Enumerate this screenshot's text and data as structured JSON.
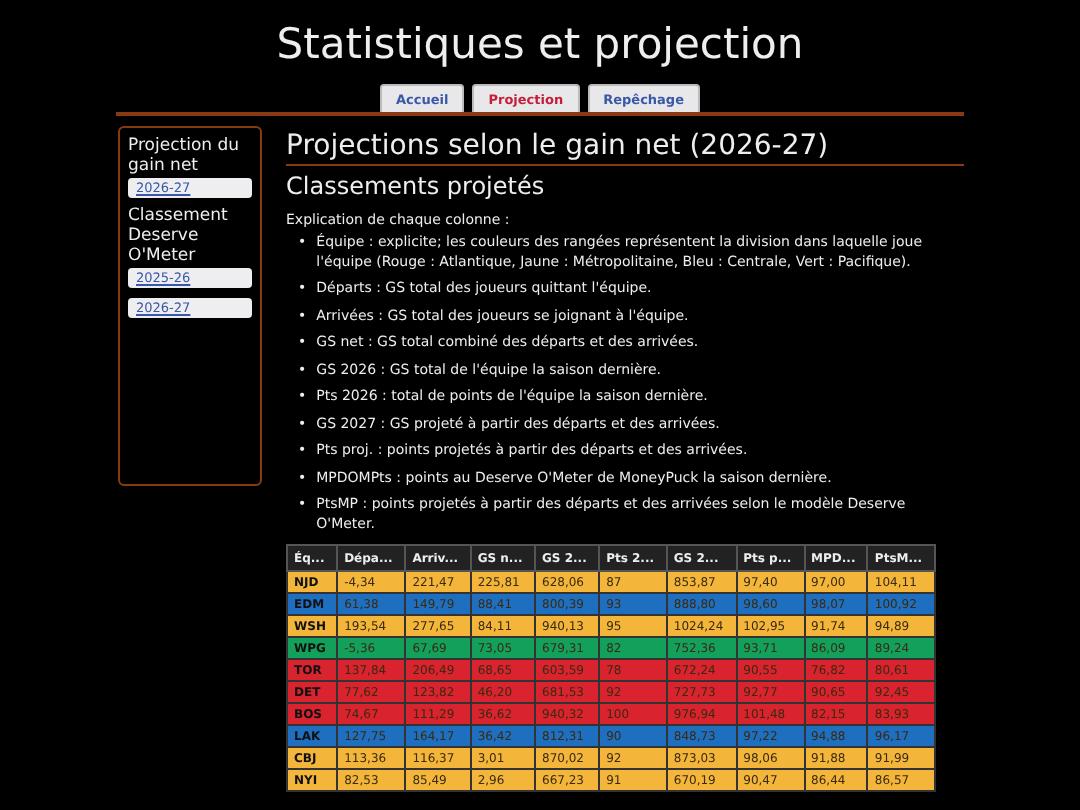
{
  "title": "Statistiques et projection",
  "tabs": [
    {
      "label": "Accueil",
      "selected": false
    },
    {
      "label": "Projection",
      "selected": true
    },
    {
      "label": "Repêchage",
      "selected": false
    }
  ],
  "sidebar": [
    {
      "label": "Projection du gain net",
      "links": [
        "2026-27"
      ]
    },
    {
      "label": "Classement Deserve O'Meter",
      "links": [
        "2025-26",
        "2026-27"
      ]
    }
  ],
  "heading": "Projections selon le gain net (2026-27)",
  "subheading": "Classements projetés",
  "intro": "Explication de chaque colonne :",
  "explanations": [
    {
      "marker": "•",
      "text": "Équipe : explicite; les couleurs des rangées représentent la division dans laquelle joue l'équipe (Rouge : Atlantique, Jaune : Métropolitaine, Bleu : Centrale, Vert : Pacifique)."
    },
    {
      "marker": "•",
      "text": "Départs : GS total des joueurs quittant l'équipe."
    },
    {
      "marker": "•",
      "text": "Arrivées : GS total des joueurs se joignant à l'équipe."
    },
    {
      "marker": "•",
      "text": "GS net : GS total combiné des départs et des arrivées."
    },
    {
      "marker": "•",
      "text": "GS 2026 : GS total de l'équipe la saison dernière."
    },
    {
      "marker": "•",
      "text": "Pts 2026 : total de points de l'équipe la saison dernière."
    },
    {
      "marker": "•",
      "text": "GS 2027 : GS projeté à partir des départs et des arrivées."
    },
    {
      "marker": "•",
      "text": "Pts proj. : points projetés à partir des départs et des arrivées."
    },
    {
      "marker": "•",
      "text": "MPDOMPts : points au Deserve O'Meter de MoneyPuck la saison dernière."
    },
    {
      "marker": "•",
      "text": "PtsMP : points projetés à partir des départs et des arrivées selon le modèle Deserve O'Meter."
    }
  ],
  "table": {
    "columns": [
      "Éq...",
      "Dépa...",
      "Arriv...",
      "GS n...",
      "GS 2...",
      "Pts 2...",
      "GS 2...",
      "Pts p...",
      "MPD...",
      "PtsM..."
    ],
    "rows": [
      {
        "color": "#f4b63a",
        "cells": [
          "NJD",
          "-4,34",
          "221,47",
          "225,81",
          "628,06",
          "87",
          "853,87",
          "97,40",
          "97,00",
          "104,11"
        ]
      },
      {
        "color": "#1f6fc0",
        "cells": [
          "EDM",
          "61,38",
          "149,79",
          "88,41",
          "800,39",
          "93",
          "888,80",
          "98,60",
          "98,07",
          "100,92"
        ]
      },
      {
        "color": "#f4b63a",
        "cells": [
          "WSH",
          "193,54",
          "277,65",
          "84,11",
          "940,13",
          "95",
          "1024,24",
          "102,95",
          "91,74",
          "94,89"
        ]
      },
      {
        "color": "#12a05a",
        "cells": [
          "WPG",
          "-5,36",
          "67,69",
          "73,05",
          "679,31",
          "82",
          "752,36",
          "93,71",
          "86,09",
          "89,24"
        ]
      },
      {
        "color": "#d9232e",
        "cells": [
          "TOR",
          "137,84",
          "206,49",
          "68,65",
          "603,59",
          "78",
          "672,24",
          "90,55",
          "76,82",
          "80,61"
        ]
      },
      {
        "color": "#d9232e",
        "cells": [
          "DET",
          "77,62",
          "123,82",
          "46,20",
          "681,53",
          "92",
          "727,73",
          "92,77",
          "90,65",
          "92,45"
        ]
      },
      {
        "color": "#d9232e",
        "cells": [
          "BOS",
          "74,67",
          "111,29",
          "36,62",
          "940,32",
          "100",
          "976,94",
          "101,48",
          "82,15",
          "83,93"
        ]
      },
      {
        "color": "#1f6fc0",
        "cells": [
          "LAK",
          "127,75",
          "164,17",
          "36,42",
          "812,31",
          "90",
          "848,73",
          "97,22",
          "94,88",
          "96,17"
        ]
      },
      {
        "color": "#f4b63a",
        "cells": [
          "CBJ",
          "113,36",
          "116,37",
          "3,01",
          "870,02",
          "92",
          "873,03",
          "98,06",
          "91,88",
          "91,99"
        ]
      },
      {
        "color": "#f4b63a",
        "cells": [
          "NYI",
          "82,53",
          "85,49",
          "2,96",
          "667,23",
          "91",
          "670,19",
          "90,47",
          "86,44",
          "86,57"
        ]
      }
    ]
  }
}
